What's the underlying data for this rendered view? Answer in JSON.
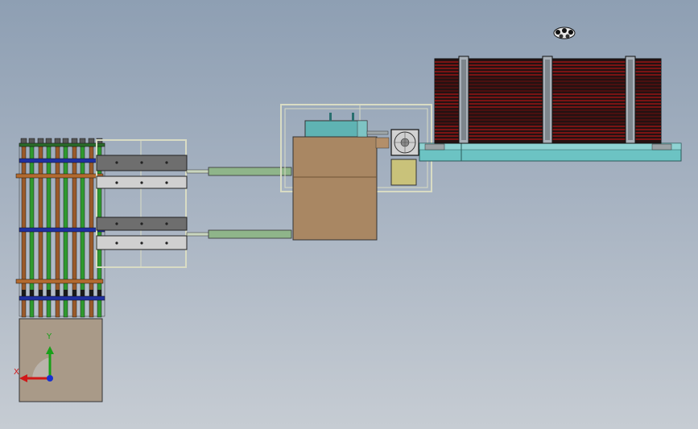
{
  "viewport": {
    "background_top": "#8e9fb3",
    "background_bottom": "#c6ccd3"
  },
  "triad": {
    "x_label": "X",
    "y_label": "Y",
    "x_color": "#d01818",
    "y_color": "#18a018",
    "z_color": "#1830d0"
  },
  "colors": {
    "frame": "#d9dcc4",
    "tan_box": "#a98763",
    "base_box": "#a99a88",
    "teal_rail": "#6cc3c3",
    "green_rod": "#2f9a2f",
    "orange_rod": "#9a5a2a",
    "blue_bar": "#1f2fa0",
    "sage_arm": "#8fb58a",
    "coil_red": "#7a1414",
    "coil_dark": "#241212",
    "motor_teal": "#5fb3b3",
    "motor_yellow": "#c9c27a"
  },
  "model_parts": [
    "bus-bar-rack",
    "clamp-frame",
    "transfer-arm",
    "central-housing",
    "coil-stack",
    "conveyor-rail",
    "base-block"
  ],
  "icons": [
    "view-cube-icon",
    "coordinate-triad-icon"
  ]
}
